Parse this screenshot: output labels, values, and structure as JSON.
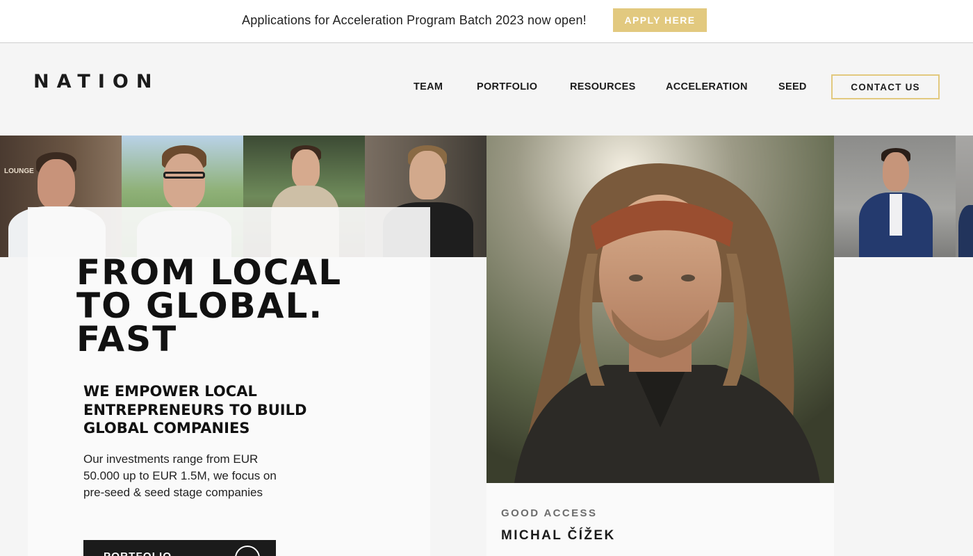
{
  "announcement": {
    "text": "Applications for Acceleration Program Batch 2023 now open!",
    "button_label": "APPLY HERE"
  },
  "header": {
    "logo": "NATION",
    "nav": [
      {
        "label": "TEAM"
      },
      {
        "label": "PORTFOLIO"
      },
      {
        "label": "RESOURCES"
      },
      {
        "label": "ACCELERATION"
      },
      {
        "label": "SEED"
      }
    ],
    "contact_label": "CONTACT US"
  },
  "photo_strip": {
    "sign_text": "LOUNGE"
  },
  "hero": {
    "title": "FROM LOCAL\nTO GLOBAL.\nFAST",
    "subtitle": "WE EMPOWER LOCAL ENTREPRENEURS TO BUILD GLOBAL COMPANIES",
    "body": "Our investments range from EUR 50.000 up to EUR 1.5M, we focus on pre-seed & seed stage companies",
    "button_label": "PORTFOLIO"
  },
  "featured": {
    "company": "GOOD ACCESS",
    "name": "MICHAL ČÍŽEK"
  },
  "colors": {
    "accent_gold": "#e2c97f",
    "dark": "#1b1b1b",
    "page_bg": "#f5f5f5"
  }
}
